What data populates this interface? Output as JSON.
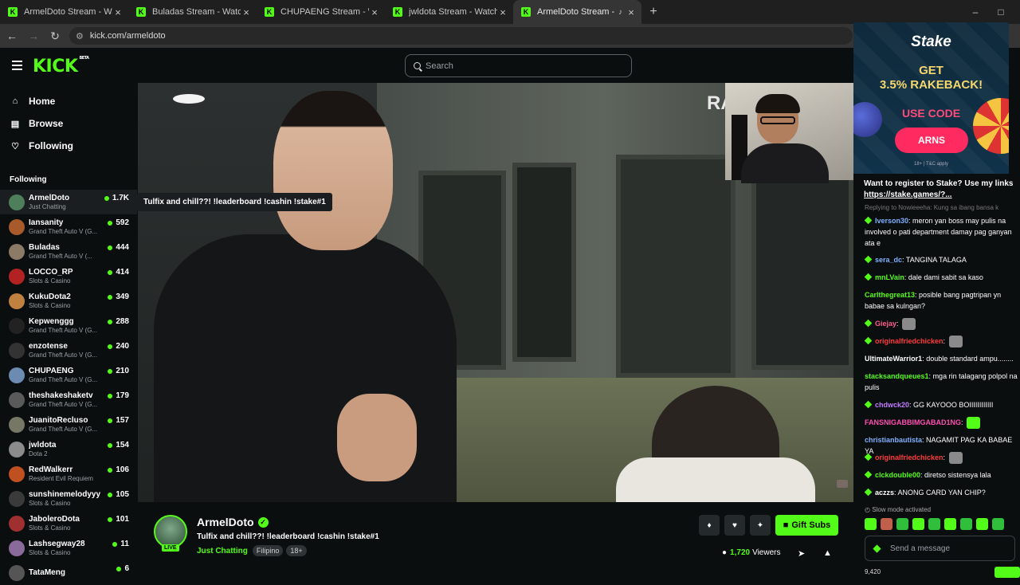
{
  "browser": {
    "tabs": [
      {
        "title": "ArmelDoto Stream - Watch Live",
        "active": false
      },
      {
        "title": "Buladas Stream - Watch Live on",
        "active": false
      },
      {
        "title": "CHUPAENG Stream - Watch Live",
        "active": false
      },
      {
        "title": "jwldota Stream - Watch Live on",
        "active": false
      },
      {
        "title": "ArmelDoto Stream - Watch",
        "active": true
      }
    ],
    "url": "kick.com/armeldoto"
  },
  "header": {
    "logo": "KICK",
    "logo_beta": "BETA",
    "search_placeholder": "Search"
  },
  "sidebar": {
    "nav": [
      {
        "label": "Home",
        "icon": "home-icon"
      },
      {
        "label": "Browse",
        "icon": "browse-icon"
      },
      {
        "label": "Following",
        "icon": "heart-icon"
      }
    ],
    "following_heading": "Following",
    "channels": [
      {
        "name": "ArmelDoto",
        "category": "Just Chatting",
        "viewers": "1.7K",
        "avatar_color": "#4f7f5a"
      },
      {
        "name": "Iansanity",
        "category": "Grand Theft Auto V (G...",
        "viewers": "592",
        "avatar_color": "#a85a2a"
      },
      {
        "name": "Buladas",
        "category": "Grand Theft Auto V (...",
        "viewers": "444",
        "avatar_color": "#8a7a66"
      },
      {
        "name": "LOCCO_RP",
        "category": "Slots & Casino",
        "viewers": "414",
        "avatar_color": "#b22222"
      },
      {
        "name": "KukuDota2",
        "category": "Slots & Casino",
        "viewers": "349",
        "avatar_color": "#c08040"
      },
      {
        "name": "Kepwenggg",
        "category": "Grand Theft Auto V (G...",
        "viewers": "288",
        "avatar_color": "#222222"
      },
      {
        "name": "enzotense",
        "category": "Grand Theft Auto V (G...",
        "viewers": "240",
        "avatar_color": "#333333"
      },
      {
        "name": "CHUPAENG",
        "category": "Grand Theft Auto V (G...",
        "viewers": "210",
        "avatar_color": "#6b8cb0"
      },
      {
        "name": "theshakeshaketv",
        "category": "Grand Theft Auto V (G...",
        "viewers": "179",
        "avatar_color": "#5a5a5a"
      },
      {
        "name": "JuanitoRecluso",
        "category": "Grand Theft Auto V (G...",
        "viewers": "157",
        "avatar_color": "#777766"
      },
      {
        "name": "jwldota",
        "category": "Dota 2",
        "viewers": "154",
        "avatar_color": "#8b8b8b"
      },
      {
        "name": "RedWalkerr",
        "category": "Resident Evil Requiem",
        "viewers": "106",
        "avatar_color": "#c05020"
      },
      {
        "name": "sunshinemelodyyy",
        "category": "Slots & Casino",
        "viewers": "105",
        "avatar_color": "#3a3a3a"
      },
      {
        "name": "JaboleroDota",
        "category": "Slots & Casino",
        "viewers": "101",
        "avatar_color": "#a03030"
      },
      {
        "name": "Lashsegway28",
        "category": "Slots & Casino",
        "viewers": "11",
        "avatar_color": "#8a6a9a"
      },
      {
        "name": "TataMeng",
        "category": "",
        "viewers": "6",
        "avatar_color": "#555555"
      }
    ],
    "tooltip": "Tulfix and chill??! !leaderboard !cashin !stake#1"
  },
  "video": {
    "overlay_text": "RA"
  },
  "stream": {
    "streamer": "ArmelDoto",
    "live_label": "LIVE",
    "title": "Tulfix and chill??! !leaderboard !cashin !stake#1",
    "category": "Just Chatting",
    "tags": [
      "Filipino",
      "18+"
    ],
    "gift_label": "Gift Subs",
    "viewers": "1,720",
    "viewers_label": "Viewers"
  },
  "ad": {
    "brand": "Stake",
    "line1": "GET",
    "line2": "3.5% RAKEBACK!",
    "use_code": "USE CODE",
    "code": "ARNS",
    "tc": "18+ | T&C apply"
  },
  "chat": {
    "pinned_text": "Want to register to Stake? Use my links",
    "pinned_link": "https://stake.games/?...",
    "replying": "Replying to Nowieeeha: Kung sa ibang bansa k",
    "messages": [
      {
        "user": "Iverson30",
        "color": "#7fb0ff",
        "badge": true,
        "text": "meron yan boss may pulis na involved o pati department damay pag ganyan ata e",
        "emote": null
      },
      {
        "user": "sera_dc",
        "color": "#7fb0ff",
        "badge": true,
        "text": "TANGINA TALAGA",
        "emote": null
      },
      {
        "user": "mnLVain",
        "color": "#53fc18",
        "badge": true,
        "text": "dale dami sabit sa kaso",
        "emote": null
      },
      {
        "user": "Carlthegreat13",
        "color": "#53fc18",
        "badge": false,
        "text": "posible bang pagtripan yn babae sa kulngan?",
        "emote": null
      },
      {
        "user": "Giejay",
        "color": "#ff5e8a",
        "badge": true,
        "text": "",
        "emote": "#8a8a8a"
      },
      {
        "user": "originalfriedchicken",
        "color": "#ff3b3b",
        "badge": true,
        "text": "",
        "emote": "#8a8a8a"
      },
      {
        "user": "UltimateWarrior1",
        "color": "#ffffff",
        "badge": false,
        "text": "double standard ampu........",
        "emote": null
      },
      {
        "user": "stacksandqueues1",
        "color": "#53fc18",
        "badge": false,
        "text": "mga rin talagang polpol na pulis",
        "emote": null
      },
      {
        "user": "chdwck20",
        "color": "#c27cff",
        "badge": true,
        "text": "GG KAYOOO BOIIIIIIIIIIII",
        "emote": null
      },
      {
        "user": "FANSNIGABBIMGABAD1NG",
        "color": "#ff4fb0",
        "badge": false,
        "text": "",
        "emote": "#53fc18"
      },
      {
        "user": "christianbautista",
        "color": "#7fb0ff",
        "badge": false,
        "text": "NAGAMIT PAG KA BABAE YA",
        "emote": null
      },
      {
        "user": "originalfriedchicken",
        "color": "#ff3b3b",
        "badge": true,
        "text": "",
        "emote": "#8a8a8a"
      },
      {
        "user": "clckdouble00",
        "color": "#53fc18",
        "badge": true,
        "text": "diretso sistensya lala",
        "emote": null
      },
      {
        "user": "aczzs",
        "color": "#ffffff",
        "badge": true,
        "text": "ANONG CARD YAN CHIP?",
        "emote": null
      }
    ],
    "slow_mode": "Slow mode activated",
    "input_placeholder": "Send a message",
    "bottom_left": "9,420"
  }
}
